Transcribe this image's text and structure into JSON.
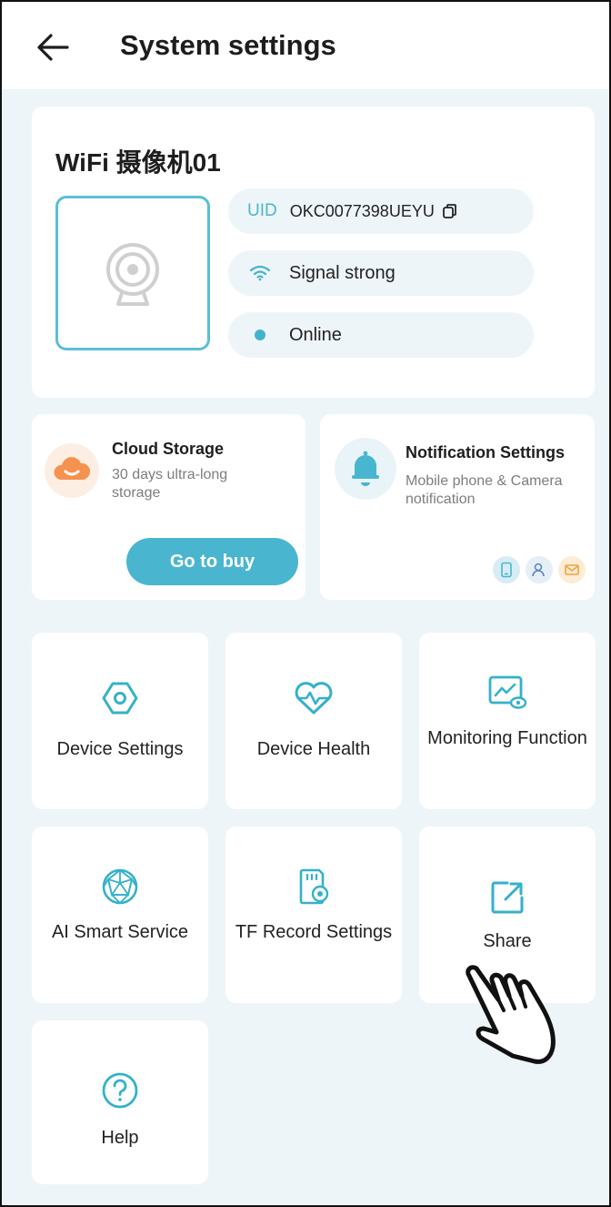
{
  "header": {
    "title": "System settings",
    "back_icon": "arrow-left-icon"
  },
  "device": {
    "name": "WiFi 摄像机01",
    "uid_label": "UID",
    "uid_value": "OKC0077398UEYU",
    "signal_text": "Signal strong",
    "status_text": "Online"
  },
  "cloud": {
    "title": "Cloud Storage",
    "description": "30 days ultra-long storage",
    "button": "Go to buy"
  },
  "notification": {
    "title": "Notification Settings",
    "description": "Mobile phone & Camera notification"
  },
  "tiles": [
    {
      "label": "Device Settings",
      "icon": "hexagon-settings-icon"
    },
    {
      "label": "Device Health",
      "icon": "heart-pulse-icon"
    },
    {
      "label": "Monitoring Function",
      "icon": "monitor-eye-icon"
    },
    {
      "label": "AI Smart Service",
      "icon": "ai-sphere-icon"
    },
    {
      "label": "TF Record Settings",
      "icon": "sd-card-icon"
    },
    {
      "label": "Share",
      "icon": "share-icon"
    },
    {
      "label": "Help",
      "icon": "help-icon"
    }
  ],
  "colors": {
    "accent": "#4ab5cf",
    "background": "#eef5f8",
    "card": "#ffffff"
  }
}
